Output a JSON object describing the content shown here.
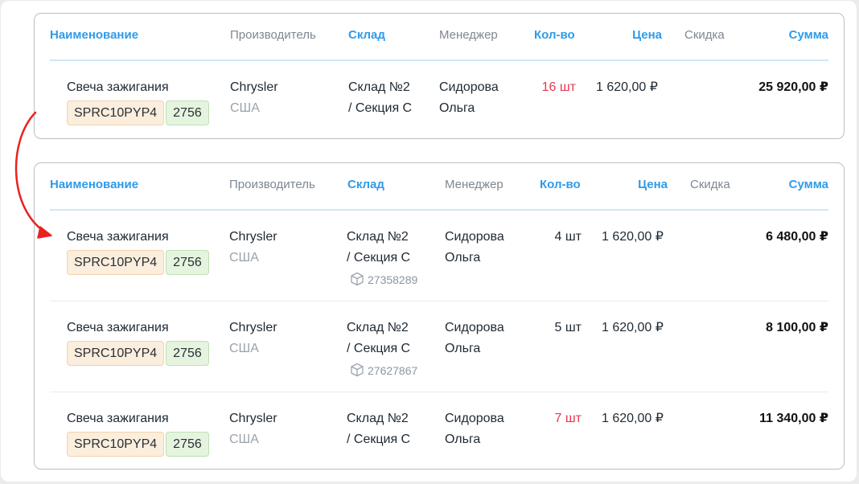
{
  "columns": {
    "name": "Наименование",
    "manufacturer": "Производитель",
    "warehouse": "Склад",
    "manager": "Менеджер",
    "qty": "Кол-во",
    "price": "Цена",
    "discount": "Скидка",
    "sum": "Сумма"
  },
  "colors": {
    "accent": "#2f9be8",
    "red_qty": "#e8374f",
    "arrow": "#e8231f",
    "chip_orange": "#fbeedd",
    "chip_green": "#e5f4df"
  },
  "top_table": {
    "rows": [
      {
        "name": "Свеча зажигания",
        "sku": "SPRC10PYP4",
        "code": "2756",
        "manufacturer": "Chrysler",
        "country": "США",
        "warehouse_line1": "Склад №2",
        "warehouse_line2": "/ Секция С",
        "manager_line1": "Сидорова",
        "manager_line2": "Ольга",
        "qty": "16 шт",
        "price": "1 620,00 ₽",
        "sum": "25 920,00 ₽"
      }
    ]
  },
  "bottom_table": {
    "rows": [
      {
        "name": "Свеча зажигания",
        "sku": "SPRC10PYP4",
        "code": "2756",
        "manufacturer": "Chrysler",
        "country": "США",
        "warehouse_line1": "Склад №2",
        "warehouse_line2": "/ Секция С",
        "box_id": "27358289",
        "manager_line1": "Сидорова",
        "manager_line2": "Ольга",
        "qty": "4 шт",
        "price": "1 620,00 ₽",
        "sum": "6 480,00 ₽"
      },
      {
        "name": "Свеча зажигания",
        "sku": "SPRC10PYP4",
        "code": "2756",
        "manufacturer": "Chrysler",
        "country": "США",
        "warehouse_line1": "Склад №2",
        "warehouse_line2": "/ Секция С",
        "box_id": "27627867",
        "manager_line1": "Сидорова",
        "manager_line2": "Ольга",
        "qty": "5 шт",
        "price": "1 620,00 ₽",
        "sum": "8 100,00 ₽"
      },
      {
        "name": "Свеча зажигания",
        "sku": "SPRC10PYP4",
        "code": "2756",
        "manufacturer": "Chrysler",
        "country": "США",
        "warehouse_line1": "Склад №2",
        "warehouse_line2": "/ Секция С",
        "manager_line1": "Сидорова",
        "manager_line2": "Ольга",
        "qty": "7 шт",
        "price": "1 620,00 ₽",
        "sum": "11 340,00 ₽"
      }
    ]
  }
}
